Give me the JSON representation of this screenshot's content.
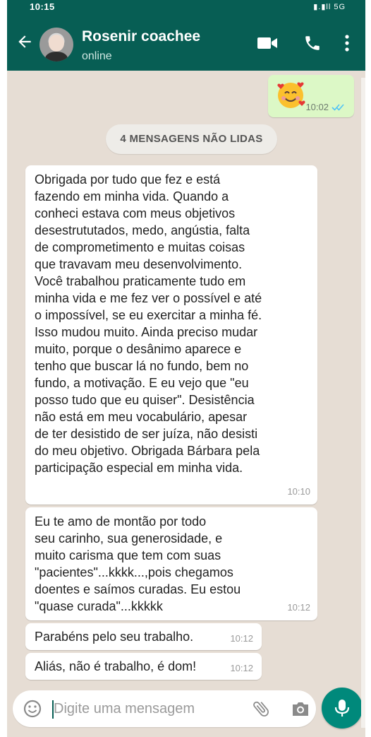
{
  "status_bar": {
    "time": "10:15",
    "icons": "▮.▮ll  5G"
  },
  "header": {
    "contact_name": "Rosenir coachee",
    "status": "online",
    "icons": [
      "back-arrow-icon",
      "video-call-icon",
      "phone-icon",
      "more-options-icon"
    ]
  },
  "outgoing": [
    {
      "content": "smiling-face-with-hearts-emoji",
      "time": "10:02",
      "status": "read"
    }
  ],
  "unread_banner": "4 MENSAGENS NÃO LIDAS",
  "incoming": [
    {
      "text": "Obrigada por tudo que fez e está\nfazendo em minha vida. Quando a\nconheci estava com meus objetivos\ndesestrututados, medo, angústia, falta\nde comprometimento e muitas coisas\nque travavam meu desenvolvimento.\nVocê trabalhou praticamente tudo em\nminha vida e me fez ver o possível e até\no impossível, se eu exercitar a minha fé.\nIsso mudou muito. Ainda preciso mudar\nmuito, porque o desânimo aparece e\ntenho que buscar lá no fundo, bem no\nfundo, a motivação. E eu vejo que \"eu\nposso tudo que eu quiser\". Desistência\nnão está em meu vocabulário, apesar\nde ter desistido de ser juíza, não desisti\ndo meu objetivo. Obrigada Bárbara pela\nparticipação especial em minha vida.",
      "time": "10:10"
    },
    {
      "text": "Eu te amo de montão por todo\nseu carinho, sua generosidade, e\nmuito carisma que tem com suas\n\"pacientes\"...kkkk...,pois chegamos\ndoentes e saímos curadas. Eu estou\n\"quase curada\"...kkkkk",
      "time": "10:12"
    },
    {
      "text": "Parabéns pelo seu trabalho.",
      "time": "10:12"
    },
    {
      "text": "Aliás, não é trabalho, é dom!",
      "time": "10:12"
    }
  ],
  "input": {
    "placeholder": "Digite uma mensagem",
    "icons": [
      "emoji-icon",
      "attach-icon",
      "camera-icon",
      "mic-icon"
    ]
  },
  "colors": {
    "header": "#075e54",
    "outgoing_bubble": "#dcf8c6",
    "incoming_bubble": "#ffffff",
    "chat_background": "#e6ddd4",
    "read_ticks": "#4fc3f7",
    "mic_button": "#00897b"
  }
}
